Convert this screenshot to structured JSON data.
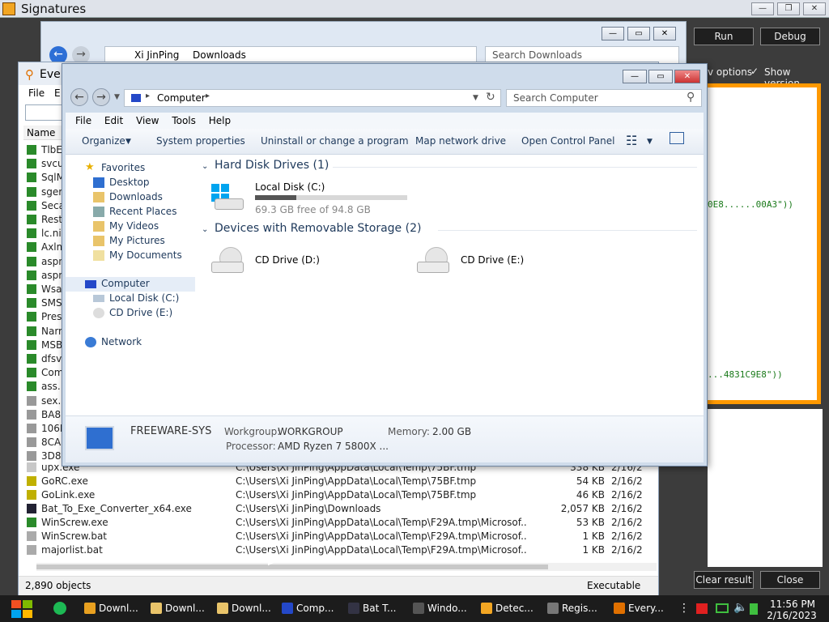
{
  "signatures": {
    "title": "Signatures",
    "run_label": "Run",
    "debug_label": "Debug",
    "options_label": "v options",
    "show_version_label": "Show version",
    "code_line_1": "0E8......00A3\"))",
    "code_line_2": "...4831C9E8\"))",
    "clear_result_label": "Clear result",
    "close_label": "Close"
  },
  "downloads_window": {
    "breadcrumb": [
      "Xi JinPing",
      "Downloads"
    ],
    "search_placeholder": "Search Downloads"
  },
  "everything": {
    "title": "Eve",
    "menu": [
      "File",
      "E"
    ],
    "col_name": "Name",
    "partial_names": [
      "TlbE",
      "svcu",
      "SqlM",
      "sger",
      "Seca",
      "Rest",
      "lc.ni",
      "Axlm",
      "aspn",
      "aspn",
      "Wsa",
      "SMS",
      "Pres",
      "Narr",
      "MSB",
      "dfsv",
      "Com",
      "ass.",
      "sex.l",
      "BA8",
      "106E",
      "8CA",
      "3D8."
    ],
    "rows": [
      {
        "name": "upx.exe",
        "path": "C:\\Users\\Xi JinPing\\AppData\\Local\\Temp\\75BF.tmp",
        "size": "338 KB",
        "date": "2/16/2"
      },
      {
        "name": "GoRC.exe",
        "path": "C:\\Users\\Xi JinPing\\AppData\\Local\\Temp\\75BF.tmp",
        "size": "54 KB",
        "date": "2/16/2"
      },
      {
        "name": "GoLink.exe",
        "path": "C:\\Users\\Xi JinPing\\AppData\\Local\\Temp\\75BF.tmp",
        "size": "46 KB",
        "date": "2/16/2"
      },
      {
        "name": "Bat_To_Exe_Converter_x64.exe",
        "path": "C:\\Users\\Xi JinPing\\Downloads",
        "size": "2,057 KB",
        "date": "2/16/2"
      },
      {
        "name": "WinScrew.exe",
        "path": "C:\\Users\\Xi JinPing\\AppData\\Local\\Temp\\F29A.tmp\\Microsof...",
        "size": "53 KB",
        "date": "2/16/2"
      },
      {
        "name": "WinScrew.bat",
        "path": "C:\\Users\\Xi JinPing\\AppData\\Local\\Temp\\F29A.tmp\\Microsof...",
        "size": "1 KB",
        "date": "2/16/2"
      },
      {
        "name": "majorlist.bat",
        "path": "C:\\Users\\Xi JinPing\\AppData\\Local\\Temp\\F29A.tmp\\Microsof...",
        "size": "1 KB",
        "date": "2/16/2"
      }
    ],
    "status_count": "2,890 objects",
    "status_filter": "Executable"
  },
  "computer": {
    "breadcrumb": "Computer",
    "search_placeholder": "Search Computer",
    "menu": [
      "File",
      "Edit",
      "View",
      "Tools",
      "Help"
    ],
    "toolbar": [
      "Organize",
      "System properties",
      "Uninstall or change a program",
      "Map network drive",
      "Open Control Panel"
    ],
    "nav": {
      "favorites": "Favorites",
      "fav_items": [
        "Desktop",
        "Downloads",
        "Recent Places",
        "My Videos",
        "My Pictures",
        "My Documents"
      ],
      "computer": "Computer",
      "computer_items": [
        "Local Disk (C:)",
        "CD Drive (E:)"
      ],
      "network": "Network"
    },
    "hdd_header": "Hard Disk Drives (1)",
    "local_disk": {
      "label": "Local Disk (C:)",
      "free": "69.3 GB free of 94.8 GB",
      "used_fraction": 0.27
    },
    "removable_header": "Devices with Removable Storage (2)",
    "cd_d": "CD Drive (D:)",
    "cd_e": "CD Drive (E:)",
    "details": {
      "name": "FREEWARE-SYS",
      "workgroup_label": "Workgroup:",
      "workgroup": "WORKGROUP",
      "memory_label": "Memory:",
      "memory": "2.00 GB",
      "processor_label": "Processor:",
      "processor": "AMD Ryzen 7 5800X ..."
    }
  },
  "taskbar": {
    "tasks": [
      "Downl...",
      "Downl...",
      "Downl...",
      "Comp...",
      "Bat T...",
      "Windo...",
      "Detec...",
      "Regis...",
      "Every..."
    ],
    "time": "11:56 PM",
    "date": "2/16/2023"
  }
}
